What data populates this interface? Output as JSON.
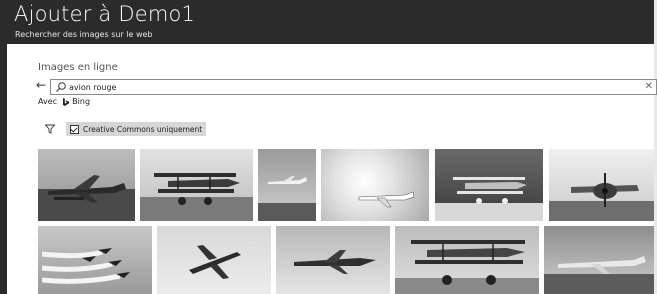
{
  "app": {
    "title": "Ajouter à Demo1",
    "subtitle": "Rechercher des images sur le web"
  },
  "dialog": {
    "title": "Images en ligne",
    "back_icon": "arrow-left-icon",
    "search": {
      "value": "avion rouge",
      "icon": "search-icon",
      "clear_icon": "close-icon"
    },
    "provider": {
      "prefix": "Avec",
      "name": "Bing",
      "logo": "bing-logo-icon"
    },
    "filter": {
      "icon": "filter-icon",
      "creative_commons_label": "Creative Commons uniquement",
      "creative_commons_checked": true
    }
  },
  "results": {
    "row1": [
      {
        "subject": "red plane on tarmac",
        "selected": true
      },
      {
        "subject": "biplane on airfield"
      },
      {
        "subject": "jet taking off"
      },
      {
        "subject": "airliner in clouds"
      },
      {
        "subject": "biplane side view"
      },
      {
        "subject": "propeller plane front"
      }
    ],
    "row2": [
      {
        "subject": "formation flight with smoke"
      },
      {
        "subject": "twin engine bomber"
      },
      {
        "subject": "jet in flight"
      },
      {
        "subject": "biplane airshow"
      },
      {
        "subject": "plane at airport"
      }
    ]
  },
  "colors": {
    "titlebar": "#2b2b2b",
    "filter_chip": "#d6d6d6"
  }
}
